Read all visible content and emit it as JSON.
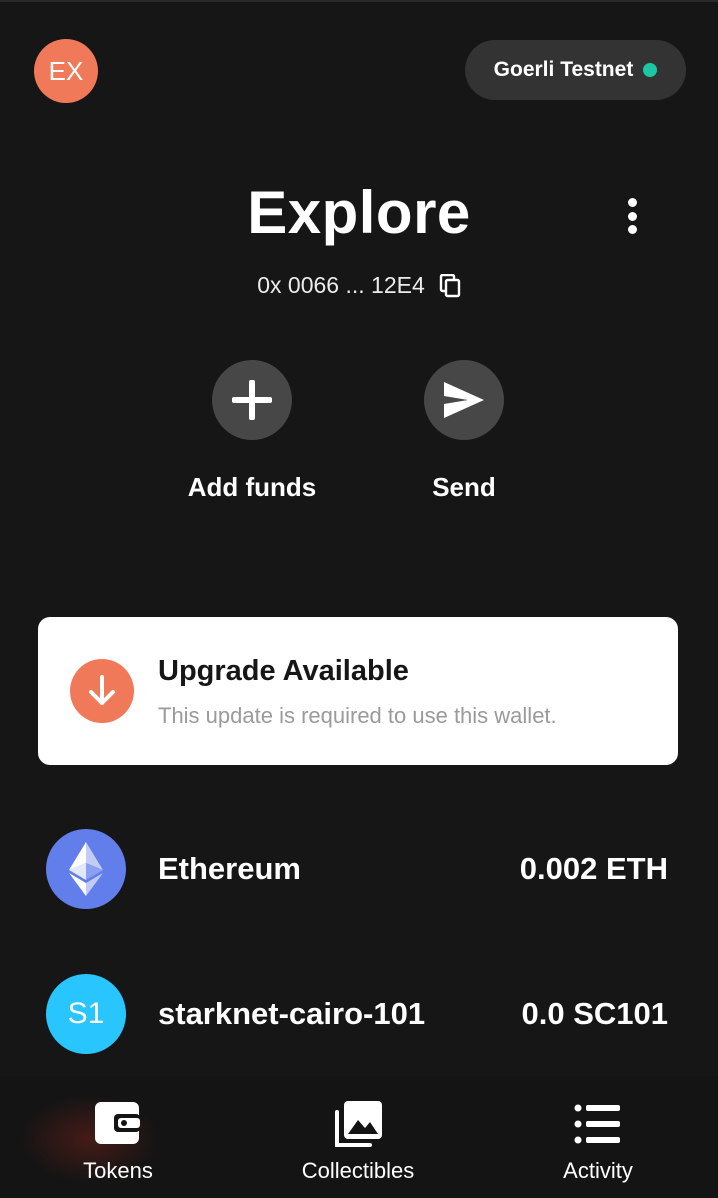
{
  "account": {
    "avatar_initials": "EX",
    "name": "Explore",
    "address": "0x 0066 ... 12E4"
  },
  "network": {
    "label": "Goerli Testnet",
    "status_color": "#1cc8a4"
  },
  "actions": {
    "add_funds_label": "Add funds",
    "send_label": "Send"
  },
  "upgrade": {
    "title": "Upgrade Available",
    "subtitle": "This update is required to use this wallet."
  },
  "tokens": [
    {
      "name": "Ethereum",
      "balance": "0.002 ETH",
      "icon": "ethereum-icon",
      "color": "#627eea"
    },
    {
      "name": "starknet-cairo-101",
      "balance": "0.0 SC101",
      "icon_text": "S1",
      "color": "#29c5ff"
    }
  ],
  "nav": {
    "tokens_label": "Tokens",
    "collectibles_label": "Collectibles",
    "activity_label": "Activity"
  },
  "colors": {
    "accent": "#f0795a",
    "background": "#161616"
  }
}
